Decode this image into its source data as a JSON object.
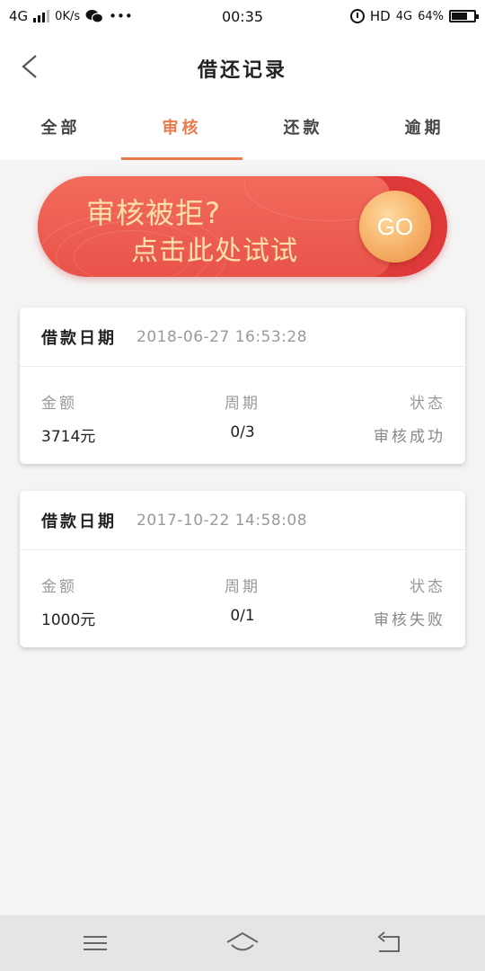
{
  "status_bar": {
    "network": "4G",
    "speed": "0K/s",
    "more": "•••",
    "time": "00:35",
    "hd": "HD",
    "network_right": "4G",
    "battery": "64%"
  },
  "header": {
    "title": "借还记录"
  },
  "tabs": [
    {
      "label": "全部"
    },
    {
      "label": "审核"
    },
    {
      "label": "还款"
    },
    {
      "label": "逾期"
    }
  ],
  "banner": {
    "line1": "审核被拒?",
    "line2": "点击此处试试",
    "go_label": "GO"
  },
  "records": [
    {
      "date_label": "借款日期",
      "date": "2018-06-27 16:53:28",
      "amount_label": "金额",
      "amount": "3714元",
      "period_label": "周期",
      "period": "0/3",
      "status_label": "状态",
      "status": "审核成功"
    },
    {
      "date_label": "借款日期",
      "date": "2017-10-22 14:58:08",
      "amount_label": "金额",
      "amount": "1000元",
      "period_label": "周期",
      "period": "0/1",
      "status_label": "状态",
      "status": "审核失败"
    }
  ],
  "colors": {
    "accent": "#ea7a4b",
    "banner_red": "#e9534a",
    "banner_text": "#fde0a8",
    "go_button": "#f5b066"
  },
  "icons": {
    "back": "chevron-left-icon",
    "nav_menu": "menu-icon",
    "nav_home": "home-icon",
    "nav_back": "return-icon"
  }
}
